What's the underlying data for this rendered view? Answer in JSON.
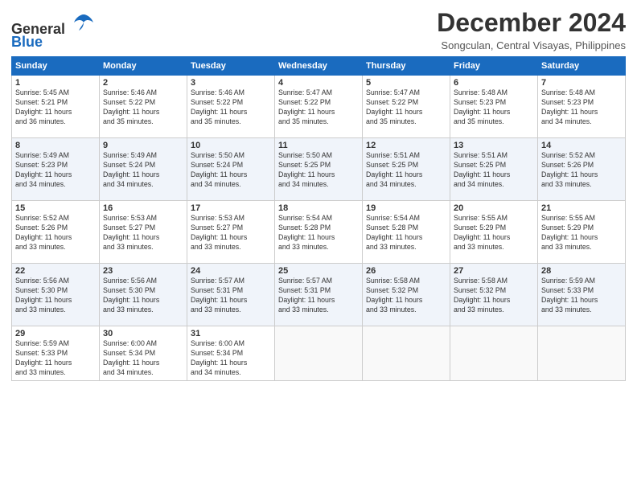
{
  "logo": {
    "line1": "General",
    "line2": "Blue"
  },
  "title": "December 2024",
  "location": "Songculan, Central Visayas, Philippines",
  "days_header": [
    "Sunday",
    "Monday",
    "Tuesday",
    "Wednesday",
    "Thursday",
    "Friday",
    "Saturday"
  ],
  "weeks": [
    [
      {
        "day": "1",
        "info": "Sunrise: 5:45 AM\nSunset: 5:21 PM\nDaylight: 11 hours\nand 36 minutes."
      },
      {
        "day": "2",
        "info": "Sunrise: 5:46 AM\nSunset: 5:22 PM\nDaylight: 11 hours\nand 35 minutes."
      },
      {
        "day": "3",
        "info": "Sunrise: 5:46 AM\nSunset: 5:22 PM\nDaylight: 11 hours\nand 35 minutes."
      },
      {
        "day": "4",
        "info": "Sunrise: 5:47 AM\nSunset: 5:22 PM\nDaylight: 11 hours\nand 35 minutes."
      },
      {
        "day": "5",
        "info": "Sunrise: 5:47 AM\nSunset: 5:22 PM\nDaylight: 11 hours\nand 35 minutes."
      },
      {
        "day": "6",
        "info": "Sunrise: 5:48 AM\nSunset: 5:23 PM\nDaylight: 11 hours\nand 35 minutes."
      },
      {
        "day": "7",
        "info": "Sunrise: 5:48 AM\nSunset: 5:23 PM\nDaylight: 11 hours\nand 34 minutes."
      }
    ],
    [
      {
        "day": "8",
        "info": "Sunrise: 5:49 AM\nSunset: 5:23 PM\nDaylight: 11 hours\nand 34 minutes."
      },
      {
        "day": "9",
        "info": "Sunrise: 5:49 AM\nSunset: 5:24 PM\nDaylight: 11 hours\nand 34 minutes."
      },
      {
        "day": "10",
        "info": "Sunrise: 5:50 AM\nSunset: 5:24 PM\nDaylight: 11 hours\nand 34 minutes."
      },
      {
        "day": "11",
        "info": "Sunrise: 5:50 AM\nSunset: 5:25 PM\nDaylight: 11 hours\nand 34 minutes."
      },
      {
        "day": "12",
        "info": "Sunrise: 5:51 AM\nSunset: 5:25 PM\nDaylight: 11 hours\nand 34 minutes."
      },
      {
        "day": "13",
        "info": "Sunrise: 5:51 AM\nSunset: 5:25 PM\nDaylight: 11 hours\nand 34 minutes."
      },
      {
        "day": "14",
        "info": "Sunrise: 5:52 AM\nSunset: 5:26 PM\nDaylight: 11 hours\nand 33 minutes."
      }
    ],
    [
      {
        "day": "15",
        "info": "Sunrise: 5:52 AM\nSunset: 5:26 PM\nDaylight: 11 hours\nand 33 minutes."
      },
      {
        "day": "16",
        "info": "Sunrise: 5:53 AM\nSunset: 5:27 PM\nDaylight: 11 hours\nand 33 minutes."
      },
      {
        "day": "17",
        "info": "Sunrise: 5:53 AM\nSunset: 5:27 PM\nDaylight: 11 hours\nand 33 minutes."
      },
      {
        "day": "18",
        "info": "Sunrise: 5:54 AM\nSunset: 5:28 PM\nDaylight: 11 hours\nand 33 minutes."
      },
      {
        "day": "19",
        "info": "Sunrise: 5:54 AM\nSunset: 5:28 PM\nDaylight: 11 hours\nand 33 minutes."
      },
      {
        "day": "20",
        "info": "Sunrise: 5:55 AM\nSunset: 5:29 PM\nDaylight: 11 hours\nand 33 minutes."
      },
      {
        "day": "21",
        "info": "Sunrise: 5:55 AM\nSunset: 5:29 PM\nDaylight: 11 hours\nand 33 minutes."
      }
    ],
    [
      {
        "day": "22",
        "info": "Sunrise: 5:56 AM\nSunset: 5:30 PM\nDaylight: 11 hours\nand 33 minutes."
      },
      {
        "day": "23",
        "info": "Sunrise: 5:56 AM\nSunset: 5:30 PM\nDaylight: 11 hours\nand 33 minutes."
      },
      {
        "day": "24",
        "info": "Sunrise: 5:57 AM\nSunset: 5:31 PM\nDaylight: 11 hours\nand 33 minutes."
      },
      {
        "day": "25",
        "info": "Sunrise: 5:57 AM\nSunset: 5:31 PM\nDaylight: 11 hours\nand 33 minutes."
      },
      {
        "day": "26",
        "info": "Sunrise: 5:58 AM\nSunset: 5:32 PM\nDaylight: 11 hours\nand 33 minutes."
      },
      {
        "day": "27",
        "info": "Sunrise: 5:58 AM\nSunset: 5:32 PM\nDaylight: 11 hours\nand 33 minutes."
      },
      {
        "day": "28",
        "info": "Sunrise: 5:59 AM\nSunset: 5:33 PM\nDaylight: 11 hours\nand 33 minutes."
      }
    ],
    [
      {
        "day": "29",
        "info": "Sunrise: 5:59 AM\nSunset: 5:33 PM\nDaylight: 11 hours\nand 33 minutes."
      },
      {
        "day": "30",
        "info": "Sunrise: 6:00 AM\nSunset: 5:34 PM\nDaylight: 11 hours\nand 34 minutes."
      },
      {
        "day": "31",
        "info": "Sunrise: 6:00 AM\nSunset: 5:34 PM\nDaylight: 11 hours\nand 34 minutes."
      },
      null,
      null,
      null,
      null
    ]
  ]
}
